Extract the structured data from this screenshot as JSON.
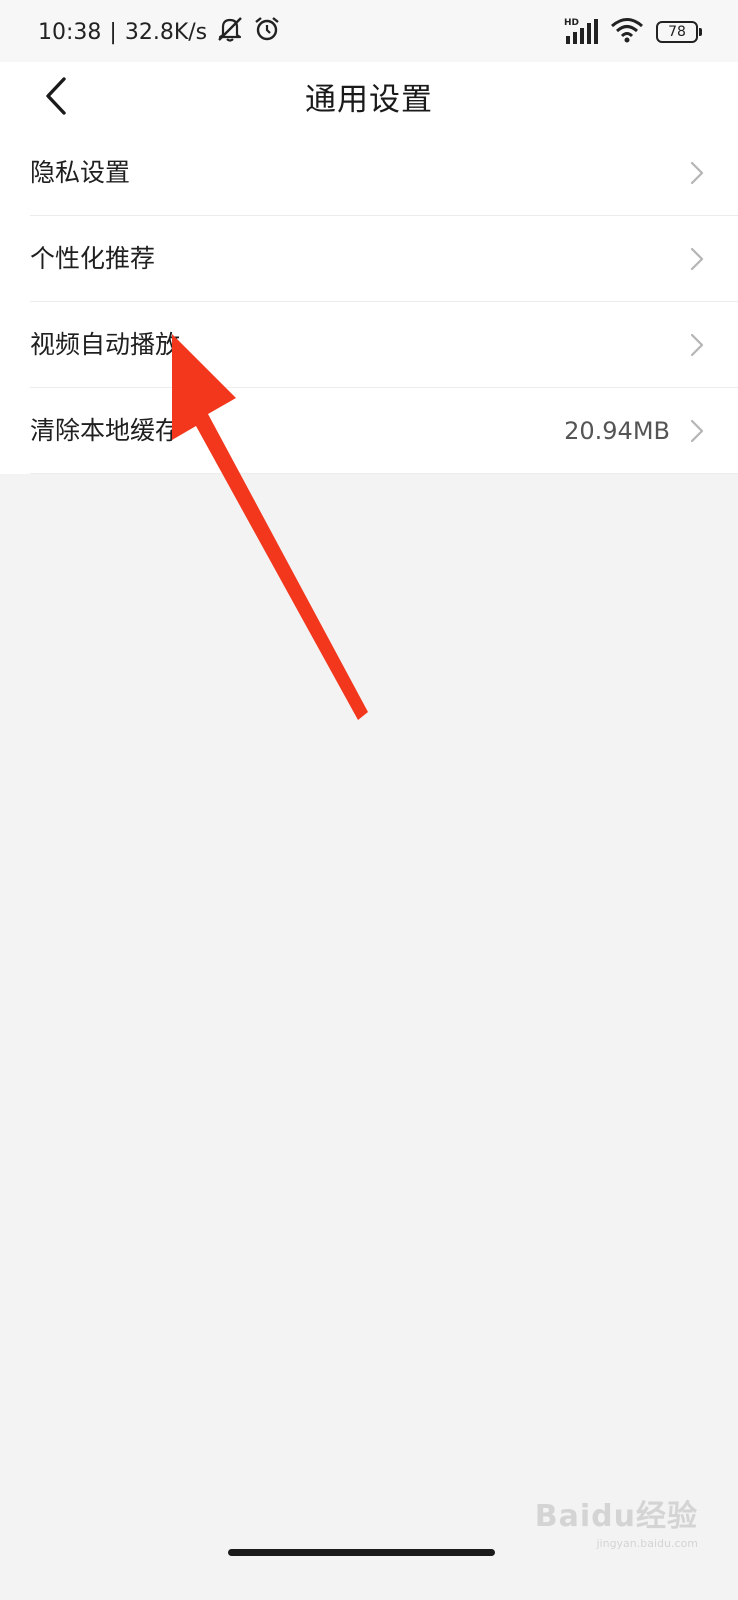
{
  "status_bar": {
    "time": "10:38",
    "separator": "|",
    "network_speed": "32.8K/s",
    "signal_label": "HD",
    "battery_level": "78"
  },
  "header": {
    "title": "通用设置"
  },
  "settings": {
    "items": [
      {
        "label": "隐私设置",
        "value": ""
      },
      {
        "label": "个性化推荐",
        "value": ""
      },
      {
        "label": "视频自动播放",
        "value": ""
      },
      {
        "label": "清除本地缓存",
        "value": "20.94MB"
      }
    ]
  },
  "watermark": {
    "logo": "Baidu经验",
    "url": "jingyan.baidu.com"
  },
  "colors": {
    "background": "#f4f3f4",
    "card": "#ffffff",
    "annotation_arrow": "#f2371c",
    "text": "#1f1f1f",
    "secondary_text": "#555555"
  }
}
